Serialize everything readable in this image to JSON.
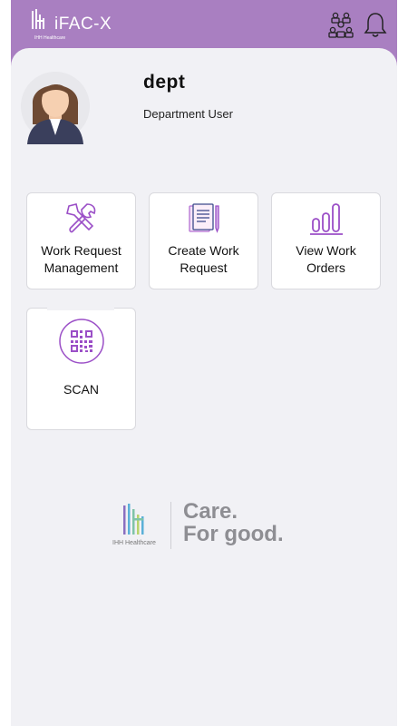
{
  "header": {
    "app_title": "iFAC-X",
    "brand_sub": "IHH Healthcare",
    "people_icon": "people-network-icon",
    "bell_icon": "bell-icon",
    "bg_color": "#a97fc1"
  },
  "profile": {
    "name": "dept",
    "role": "Department User",
    "avatar_icon": "female-avatar"
  },
  "tiles": [
    {
      "label": "Work Request Management",
      "icon": "tools-icon"
    },
    {
      "label": "Create Work Request",
      "icon": "document-pen-icon"
    },
    {
      "label": "View Work Orders",
      "icon": "bar-chart-icon"
    },
    {
      "label": "SCAN",
      "icon": "qr-code-icon"
    }
  ],
  "footer": {
    "org": "IHH Healthcare",
    "tagline_line1": "Care.",
    "tagline_line2": "For good."
  },
  "colors": {
    "accent": "#a97fc1",
    "icon_purple": "#9b4fc7",
    "background": "#f1f1f5"
  }
}
